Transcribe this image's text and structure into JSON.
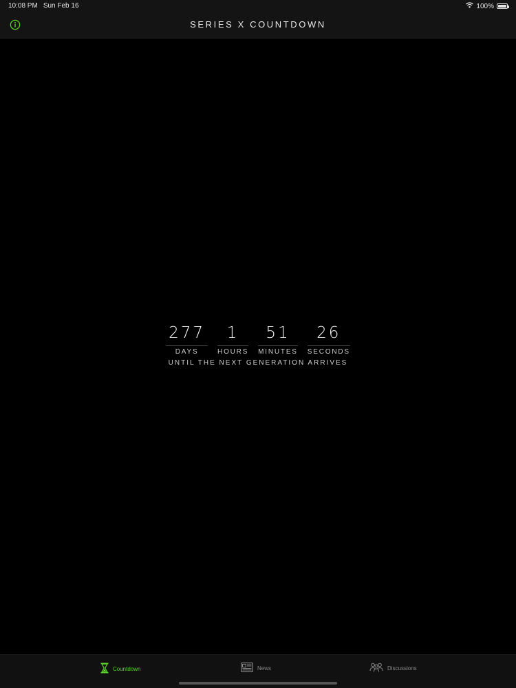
{
  "status_bar": {
    "time": "10:08 PM",
    "date": "Sun Feb 16",
    "battery_percent": "100%",
    "battery_level": 1.0
  },
  "nav": {
    "title": "SERIES X COUNTDOWN",
    "info_icon": "info-icon",
    "accent_color": "#5bd329"
  },
  "countdown": {
    "units": [
      {
        "value": "277",
        "label": "DAYS"
      },
      {
        "value": "1",
        "label": "HOURS"
      },
      {
        "value": "51",
        "label": "MINUTES"
      },
      {
        "value": "26",
        "label": "SECONDS"
      }
    ],
    "subtitle": "UNTIL THE NEXT GENERATION ARRIVES"
  },
  "tab_bar": {
    "tabs": [
      {
        "label": "Countdown",
        "icon": "hourglass-icon",
        "selected": true
      },
      {
        "label": "News",
        "icon": "newspaper-icon",
        "selected": false
      },
      {
        "label": "Discussions",
        "icon": "people-icon",
        "selected": false
      }
    ]
  }
}
